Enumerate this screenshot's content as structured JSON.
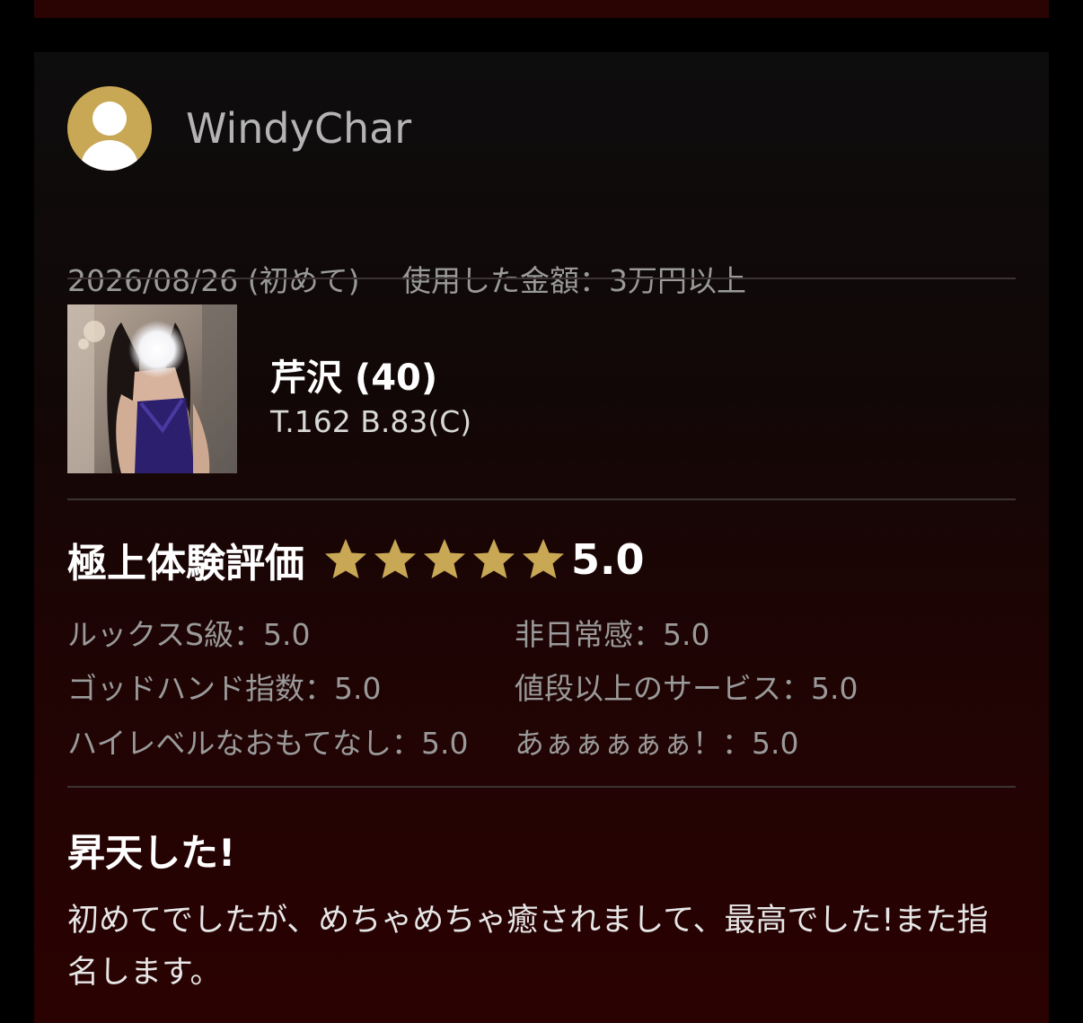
{
  "review": {
    "username": "WindyChar",
    "date": "2026/08/26",
    "visit_type": "(初めて)",
    "amount_label": "使用した金額：3万円以上",
    "girl": {
      "name": "芹沢 (40)",
      "stats": "T.162 B.83(C)"
    },
    "rating": {
      "title": "極上体験評価",
      "stars": 5,
      "score": "5.0",
      "star_color": "#c8a854",
      "items": [
        {
          "label": "ルックスS級：5.0"
        },
        {
          "label": "非日常感：5.0"
        },
        {
          "label": "ゴッドハンド指数：5.0"
        },
        {
          "label": "値段以上のサービス：5.0"
        },
        {
          "label": "ハイレベルなおもてなし：5.0"
        },
        {
          "label": "あぁぁぁぁぁ！：5.0"
        }
      ]
    },
    "title": "昇天した!",
    "body": "初めてでしたが、めちゃめちゃ癒されまして、最高でした!また指名します。"
  }
}
